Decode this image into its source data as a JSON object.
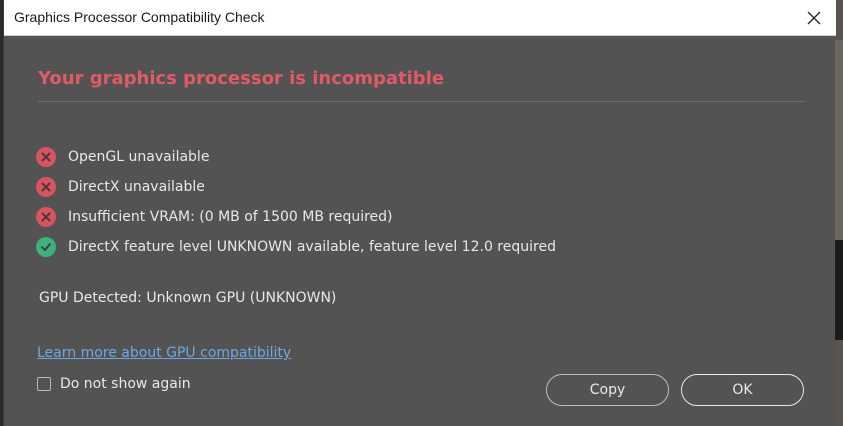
{
  "window": {
    "title": "Graphics Processor Compatibility Check",
    "close_icon": "close-icon"
  },
  "main": {
    "heading": "Your graphics processor is incompatible",
    "checks": [
      {
        "status": "fail",
        "icon": "error-x-icon",
        "text": "OpenGL unavailable"
      },
      {
        "status": "fail",
        "icon": "error-x-icon",
        "text": "DirectX unavailable"
      },
      {
        "status": "fail",
        "icon": "error-x-icon",
        "text": "Insufficient VRAM: (0 MB of 1500 MB required)"
      },
      {
        "status": "pass",
        "icon": "success-check-icon",
        "text": "DirectX feature level UNKNOWN available, feature level 12.0 required"
      }
    ],
    "gpu_detected": "GPU Detected: Unknown GPU (UNKNOWN)",
    "learn_more_link": "Learn more about GPU compatibility"
  },
  "footer": {
    "dont_show_again_label": "Do not show again",
    "dont_show_again_checked": false,
    "copy_label": "Copy",
    "ok_label": "OK"
  },
  "colors": {
    "heading": "#e05a68",
    "fail": "#d9545f",
    "pass": "#3fb17a",
    "link": "#6ea7e6",
    "dialog_bg": "#535353"
  }
}
